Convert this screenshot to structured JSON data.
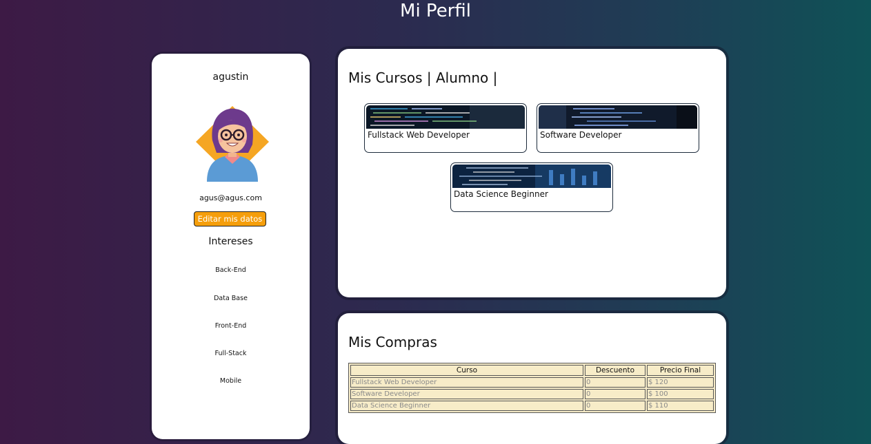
{
  "page": {
    "title": "Mi Perfil"
  },
  "profile": {
    "name": "agustin",
    "email": "agus@agus.com",
    "edit_label": "Editar mis datos",
    "interests_title": "Intereses",
    "interests": [
      "Back-End",
      "Data Base",
      "Front-End",
      "Full-Stack",
      "Mobile"
    ]
  },
  "courses": {
    "title": "Mis Cursos | Alumno |",
    "items": [
      {
        "title": "Fullstack Web Developer"
      },
      {
        "title": "Software Developer"
      },
      {
        "title": "Data Science Beginner"
      }
    ]
  },
  "purchases": {
    "title": "Mis Compras",
    "columns": [
      "Curso",
      "Descuento",
      "Precio Final"
    ],
    "rows": [
      [
        "Fullstack Web Developer",
        "0",
        "$ 120"
      ],
      [
        "Software Developer",
        "0",
        "$ 100"
      ],
      [
        "Data Science Beginner",
        "0",
        "$ 110"
      ]
    ]
  },
  "colors": {
    "accent_orange": "#f59e0b",
    "table_background": "#f7ecc8",
    "card_border": "#1c2a3a"
  }
}
